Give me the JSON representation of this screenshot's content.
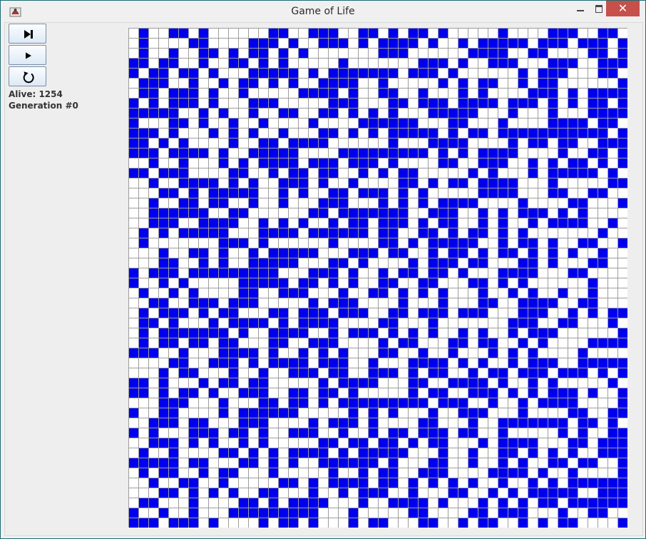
{
  "window": {
    "title": "Game of Life",
    "controls": [
      "minimize",
      "maximize",
      "close"
    ]
  },
  "toolbar": {
    "buttons": [
      {
        "name": "step-button",
        "icon": "step-forward-icon"
      },
      {
        "name": "play-button",
        "icon": "play-icon"
      },
      {
        "name": "reset-button",
        "icon": "reset-icon"
      }
    ]
  },
  "status": {
    "alive": "Alive: 1254",
    "generation": "Generation #0"
  },
  "board": {
    "rows": 50,
    "cols": 50,
    "alive_color": "#0000ee",
    "dead_color": "#ffffff",
    "line_color": "#9d9d9d",
    "alive_count": 1254
  },
  "colors": {
    "titlebar": "#f0f0f0",
    "close_button": "#c7504a",
    "frame": "#1f7f86"
  }
}
